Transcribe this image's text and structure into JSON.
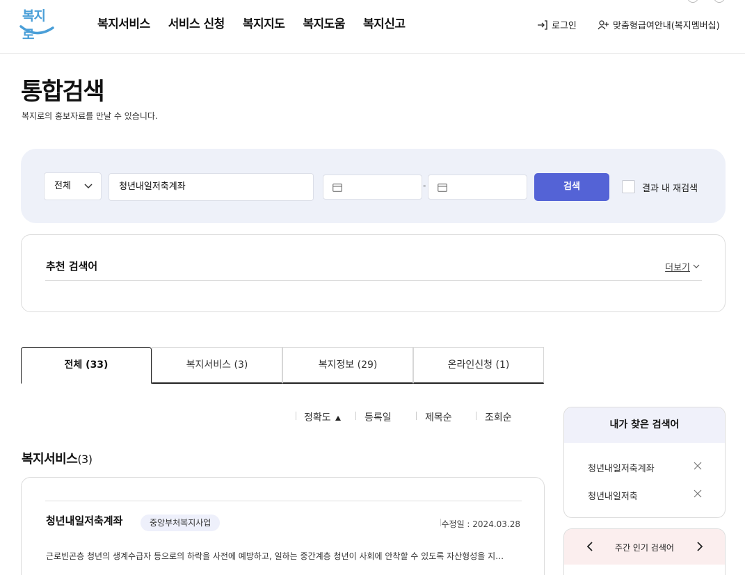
{
  "header": {
    "logo_text": "복지로",
    "nav": [
      "복지서비스",
      "서비스 신청",
      "복지지도",
      "복지도움",
      "복지신고"
    ],
    "login_label": "로그인",
    "member_label": "맞춤형급여안내(복지멤버십)"
  },
  "page": {
    "title": "통합검색",
    "description": "복지로의 홍보자료를 만날 수 있습니다."
  },
  "search": {
    "category_selected": "전체",
    "query": "청년내일저축계좌",
    "date_separator": "-",
    "button_label": "검색",
    "research_label": "결과 내 재검색",
    "research_checked": false
  },
  "recommend": {
    "title": "추천 검색어",
    "more_label": "더보기"
  },
  "tabs": [
    {
      "label": "전체 (33)",
      "active": true
    },
    {
      "label": "복지서비스 (3)",
      "active": false
    },
    {
      "label": "복지정보 (29)",
      "active": false
    },
    {
      "label": "온라인신청 (1)",
      "active": false
    }
  ],
  "sort": [
    "정확도",
    "등록일",
    "제목순",
    "조회순"
  ],
  "section": {
    "title": "복지서비스",
    "count": "(3)"
  },
  "results": [
    {
      "title": "청년내일저축계좌",
      "badge": "중앙부처복지사업",
      "date": "수정일 : 2024.03.28",
      "description": "근로빈곤층 청년의 생계수급자 등으로의 하락을 사전에 예방하고, 일하는 중간계층 청년이 사회에 안착할 수 있도록 자산형성을 지…"
    }
  ],
  "my_searches": {
    "title": "내가 찾은 검색어",
    "items": [
      "청년내일저축계좌",
      "청년내일저축"
    ]
  },
  "popular": {
    "title": "주간 인기 검색어"
  },
  "colors": {
    "primary": "#5463d6",
    "search_panel_bg": "#eef1f9",
    "side_head_bg": "#f0f1fa",
    "popular_head_bg": "#fbeeee"
  }
}
